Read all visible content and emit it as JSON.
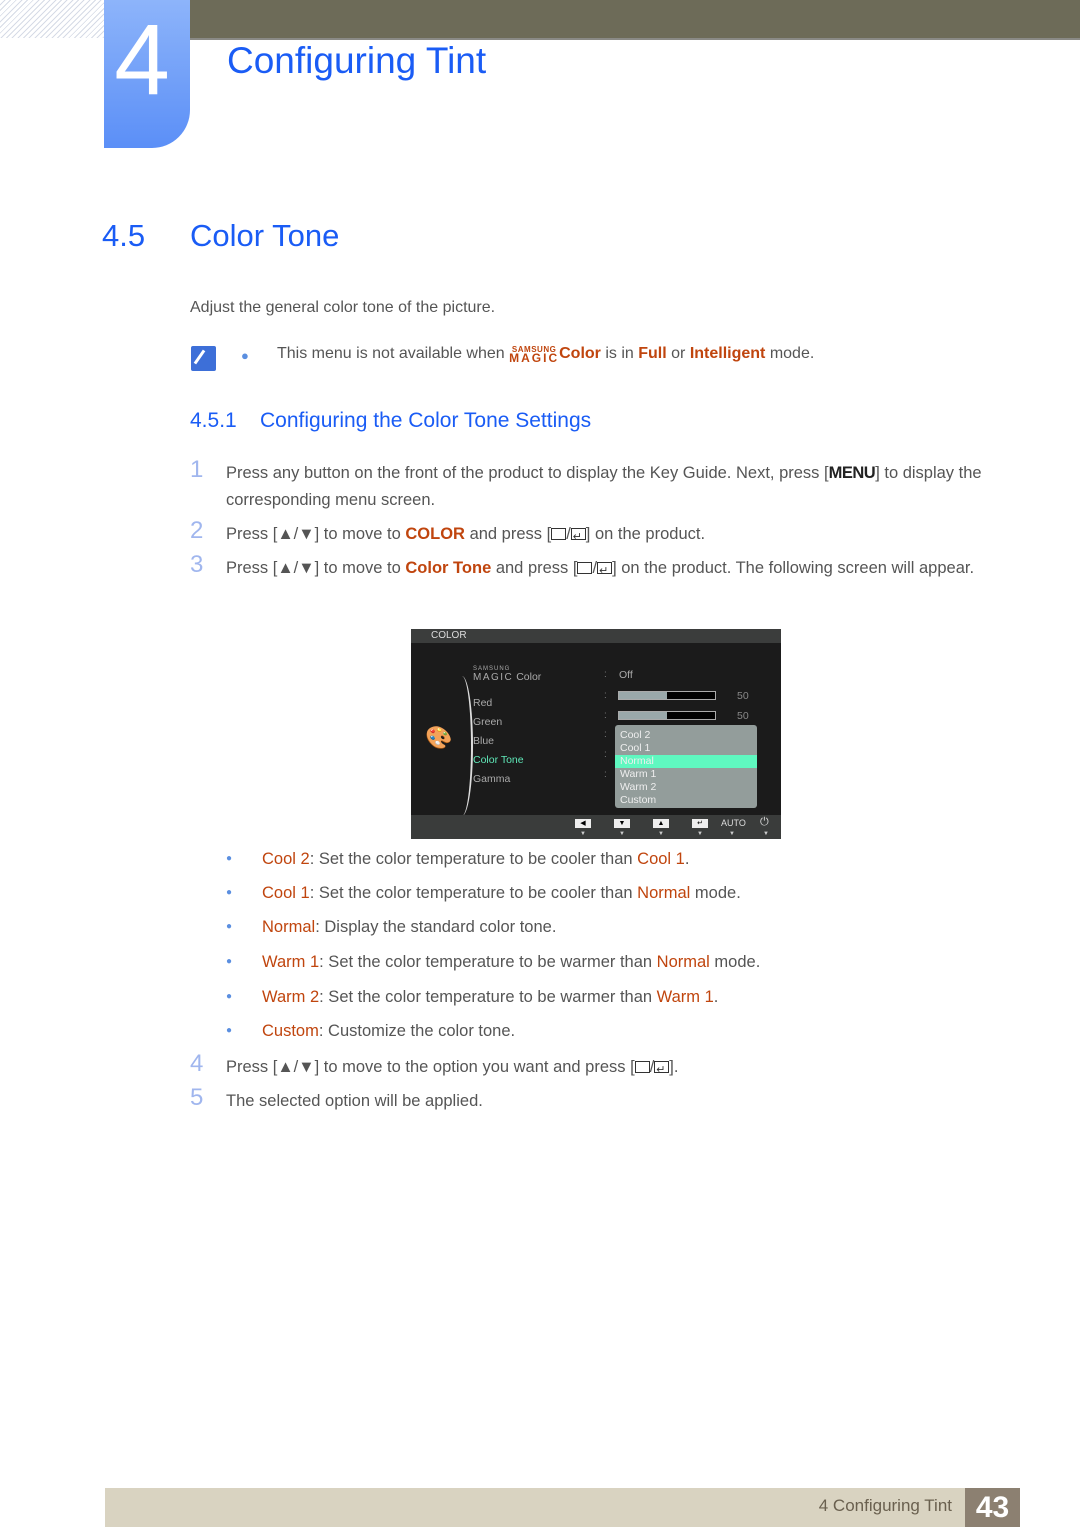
{
  "chapter": {
    "number": "4",
    "title": "Configuring Tint"
  },
  "section": {
    "number": "4.5",
    "title": "Color Tone",
    "intro": "Adjust the general color tone of the picture."
  },
  "note": {
    "text_before": "This menu is not available when ",
    "magic_small": "SAMSUNG",
    "magic_big": "MAGIC",
    "magic_word": "Color",
    "text_mid1": " is in ",
    "full": "Full",
    "text_mid2": " or ",
    "intelligent": "Intelligent",
    "text_after": " mode."
  },
  "subsection": {
    "number": "4.5.1",
    "title": "Configuring the Color Tone Settings"
  },
  "steps": [
    {
      "n": "1",
      "a": "Press any button on the front of the product to display the Key Guide. Next, press [",
      "key": "MENU",
      "b": "] to display the corresponding menu screen."
    },
    {
      "n": "2",
      "a": "Press [▲/▼] to move to ",
      "hl": "COLOR",
      "b": " and press [",
      "c": "] on the product."
    },
    {
      "n": "3",
      "a": "Press [▲/▼] to move to ",
      "hl": "Color Tone",
      "b": " and press [",
      "c": "] on the product. The following screen will appear."
    },
    {
      "n": "4",
      "a": "Press [▲/▼] to move to the option you want and press [",
      "c": "]."
    },
    {
      "n": "5",
      "a": "The selected option will be applied."
    }
  ],
  "osd": {
    "header": "COLOR",
    "magic_small": "SAMSUNG",
    "magic_big": "MAGIC",
    "items": [
      "Color",
      "Red",
      "Green",
      "Blue",
      "Color Tone",
      "Gamma"
    ],
    "magic_value": "Off",
    "red_value": "50",
    "green_value": "50",
    "red_level_pct": 50,
    "green_level_pct": 50,
    "options": [
      "Cool 2",
      "Cool 1",
      "Normal",
      "Warm 1",
      "Warm 2",
      "Custom"
    ],
    "selected_option": "Normal",
    "footer_auto": "AUTO",
    "footer_icons": [
      "left-icon",
      "down-icon",
      "up-icon",
      "enter-icon",
      "auto",
      "power-icon"
    ]
  },
  "options_desc": [
    {
      "name": "Cool 2",
      "desc": ": Set the color temperature to be cooler than ",
      "ref": "Cool 1",
      "end": "."
    },
    {
      "name": "Cool 1",
      "desc": ": Set the color temperature to be cooler than ",
      "ref": "Normal",
      "end": " mode."
    },
    {
      "name": "Normal",
      "desc": ": Display the standard color tone.",
      "ref": "",
      "end": ""
    },
    {
      "name": "Warm 1",
      "desc": ": Set the color temperature to be warmer than ",
      "ref": "Normal",
      "end": " mode."
    },
    {
      "name": "Warm 2",
      "desc": ": Set the color temperature to be warmer than ",
      "ref": "Warm 1",
      "end": "."
    },
    {
      "name": "Custom",
      "desc": ": Customize the color tone.",
      "ref": "",
      "end": ""
    }
  ],
  "footer": {
    "label": "4 Configuring Tint",
    "page": "43"
  }
}
